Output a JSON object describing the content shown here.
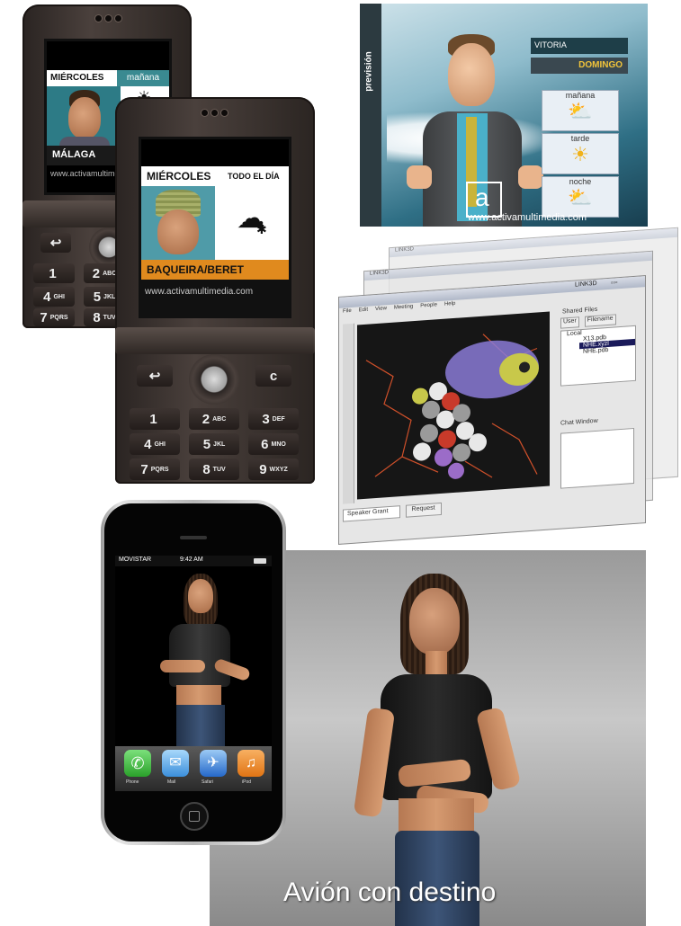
{
  "phone_back": {
    "day": "MIÉRCOLES",
    "period": "mañana",
    "city": "MÁLAGA",
    "url": "www.activamultimedia.com",
    "keys": [
      {
        "num": "1",
        "sub": ""
      },
      {
        "num": "2",
        "sub": "ABC"
      },
      {
        "num": "4",
        "sub": "GHI"
      },
      {
        "num": "5",
        "sub": "JKL"
      },
      {
        "num": "7",
        "sub": "PQRS"
      },
      {
        "num": "8",
        "sub": "TUV"
      }
    ]
  },
  "phone_front": {
    "day": "MIÉRCOLES",
    "period": "TODO EL DÍA",
    "place": "BAQUEIRA/BERET",
    "url": "www.activamultimedia.com",
    "c_key": "c",
    "keys": [
      {
        "num": "1",
        "sub": ""
      },
      {
        "num": "2",
        "sub": "ABC"
      },
      {
        "num": "3",
        "sub": "DEF"
      },
      {
        "num": "4",
        "sub": "GHI"
      },
      {
        "num": "5",
        "sub": "JKL"
      },
      {
        "num": "6",
        "sub": "MNO"
      },
      {
        "num": "7",
        "sub": "PQRS"
      },
      {
        "num": "8",
        "sub": "TUV"
      },
      {
        "num": "9",
        "sub": "WXYZ"
      }
    ]
  },
  "weather_tv": {
    "side_label": "previsión",
    "city": "VITORIA",
    "day": "DOMINGO",
    "periods": [
      "mañana",
      "tarde",
      "noche"
    ],
    "logo": "a",
    "url": "www.activamultimedia.com"
  },
  "collab_app": {
    "window_title": "LINK3D",
    "menu": [
      "File",
      "Edit",
      "View",
      "Meeting",
      "People",
      "Help"
    ],
    "shared_files_label": "Shared Files",
    "columns": [
      "User",
      "Filename"
    ],
    "tree_root": "Local",
    "files": [
      "X13.pdb",
      "NHE.xyzl",
      "NHE.pdb"
    ],
    "chat_label": "Chat Window",
    "speaker_label": "Speaker Grant",
    "request_label": "Request"
  },
  "iphone": {
    "carrier": "MOVISTAR",
    "time": "9:42 AM",
    "dock": [
      "Phone",
      "Mail",
      "Safari",
      "iPod"
    ],
    "colors": {
      "phone": "#3cc43c",
      "mail": "#4aa3e8",
      "safari": "#2f7fe0",
      "ipod": "#f08a24"
    }
  },
  "sign_video": {
    "caption": "Avión con destino"
  }
}
